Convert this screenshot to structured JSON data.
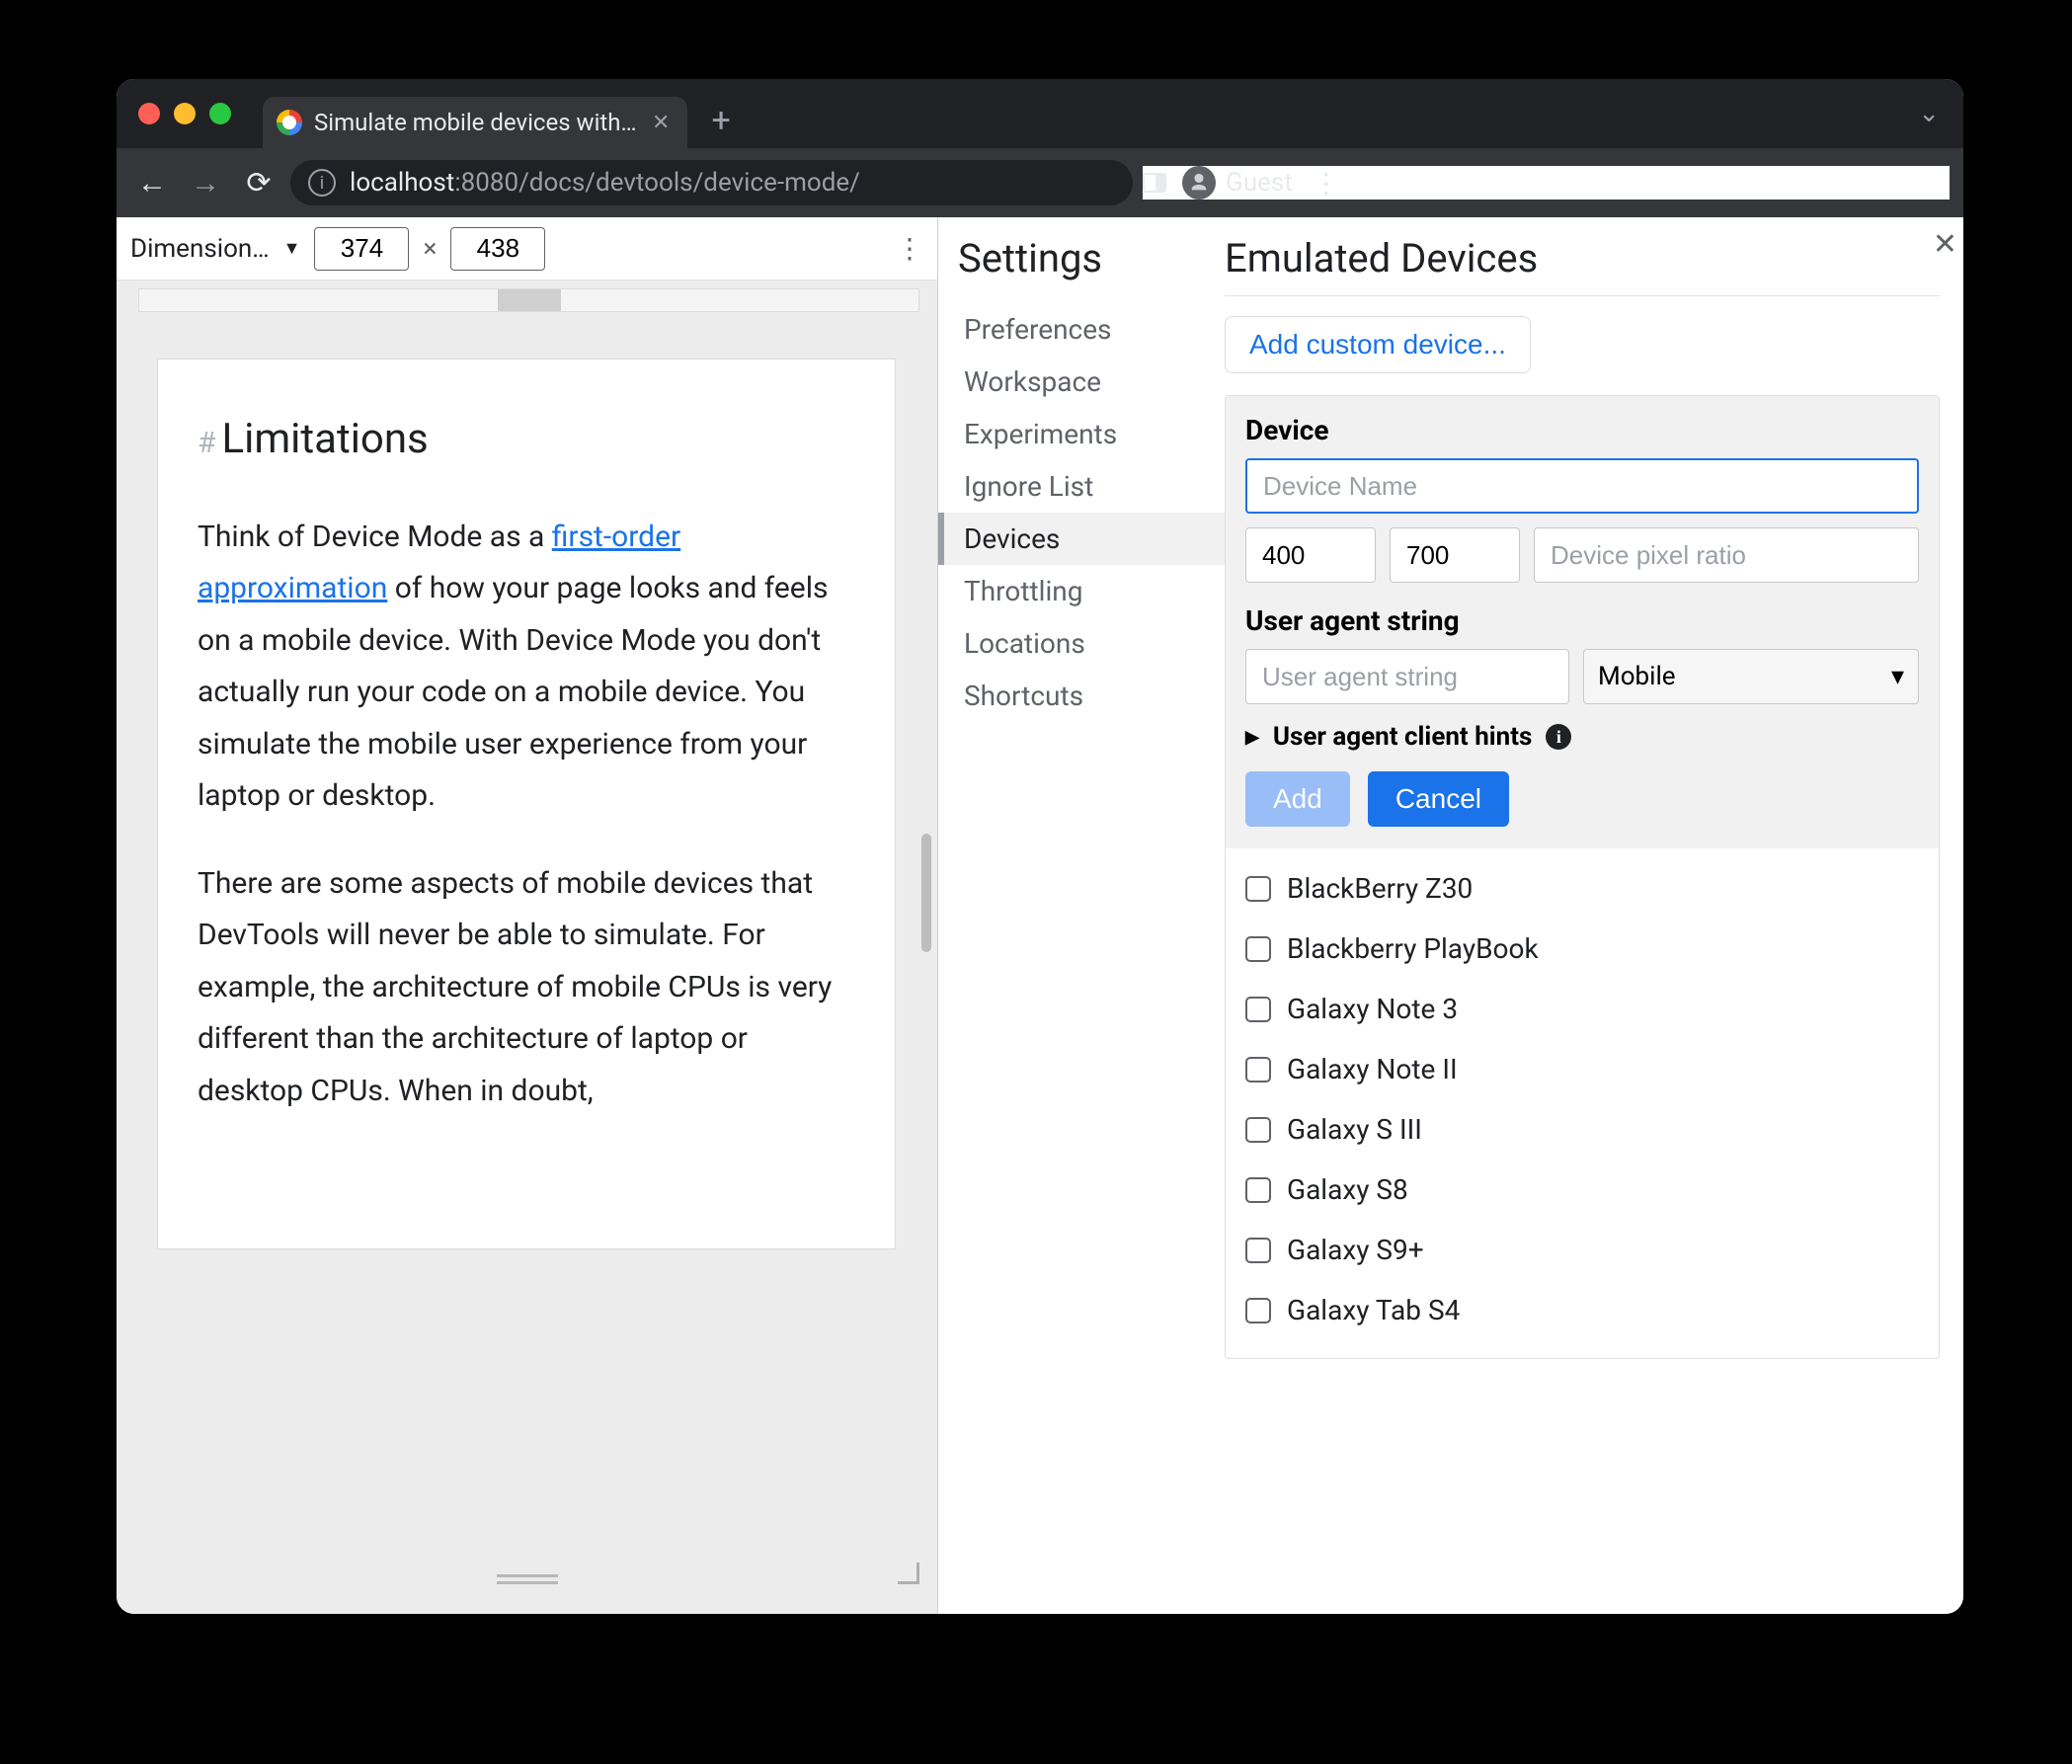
{
  "browser": {
    "tab_title": "Simulate mobile devices with D",
    "url_host": "localhost",
    "url_port": ":8080",
    "url_path": "/docs/devtools/device-mode/",
    "guest_label": "Guest"
  },
  "device_mode": {
    "dimensions_label": "Dimension…",
    "width": "374",
    "height": "438",
    "separator": "×"
  },
  "article": {
    "heading": "Limitations",
    "p1_pre": "Think of Device Mode as a ",
    "p1_link": "first-order approximation",
    "p1_post": " of how your page looks and feels on a mobile device. With Device Mode you don't actually run your code on a mobile device. You simulate the mobile user experience from your laptop or desktop.",
    "p2": "There are some aspects of mobile devices that DevTools will never be able to simulate. For example, the architecture of mobile CPUs is very different than the architecture of laptop or desktop CPUs. When in doubt,"
  },
  "settings": {
    "title": "Settings",
    "nav": [
      "Preferences",
      "Workspace",
      "Experiments",
      "Ignore List",
      "Devices",
      "Throttling",
      "Locations",
      "Shortcuts"
    ],
    "nav_selected_index": 4,
    "page_title": "Emulated Devices",
    "add_custom_label": "Add custom device...",
    "device_section_label": "Device",
    "device_name_placeholder": "Device Name",
    "width_value": "400",
    "height_value": "700",
    "dpr_placeholder": "Device pixel ratio",
    "ua_section_label": "User agent string",
    "ua_placeholder": "User agent string",
    "ua_type_value": "Mobile",
    "hints_label": "User agent client hints",
    "add_btn": "Add",
    "cancel_btn": "Cancel",
    "devices": [
      "BlackBerry Z30",
      "Blackberry PlayBook",
      "Galaxy Note 3",
      "Galaxy Note II",
      "Galaxy S III",
      "Galaxy S8",
      "Galaxy S9+",
      "Galaxy Tab S4"
    ]
  }
}
